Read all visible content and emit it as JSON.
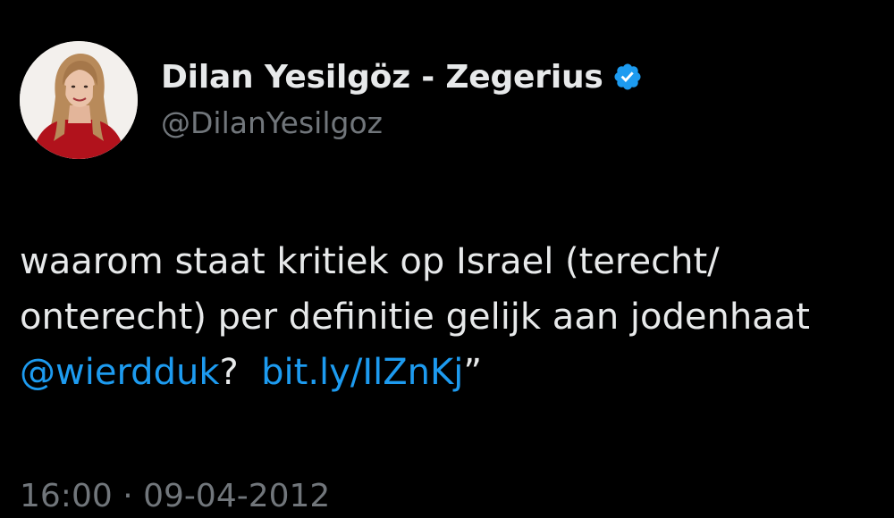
{
  "author": {
    "display_name": "Dilan Yesilgöz - Zegerius",
    "handle": "@DilanYesilgoz",
    "verified": true,
    "avatar_icon": "profile-photo-avatar",
    "verified_icon": "verified-badge-icon"
  },
  "tweet": {
    "line1": "waarom staat kritiek op Israel (terecht/",
    "line2": "onterecht) per definitie gelijk aan jodenhaat",
    "mention": "@wierdduk",
    "after_mention": "?",
    "link": "bit.ly/IlZnKj",
    "closing_quote": "”"
  },
  "meta": {
    "time": "16:00",
    "separator": "·",
    "date": "09-04-2012"
  },
  "colors": {
    "background": "#000000",
    "text": "#e7e9ea",
    "secondary": "#71767b",
    "link": "#1d9bf0"
  }
}
